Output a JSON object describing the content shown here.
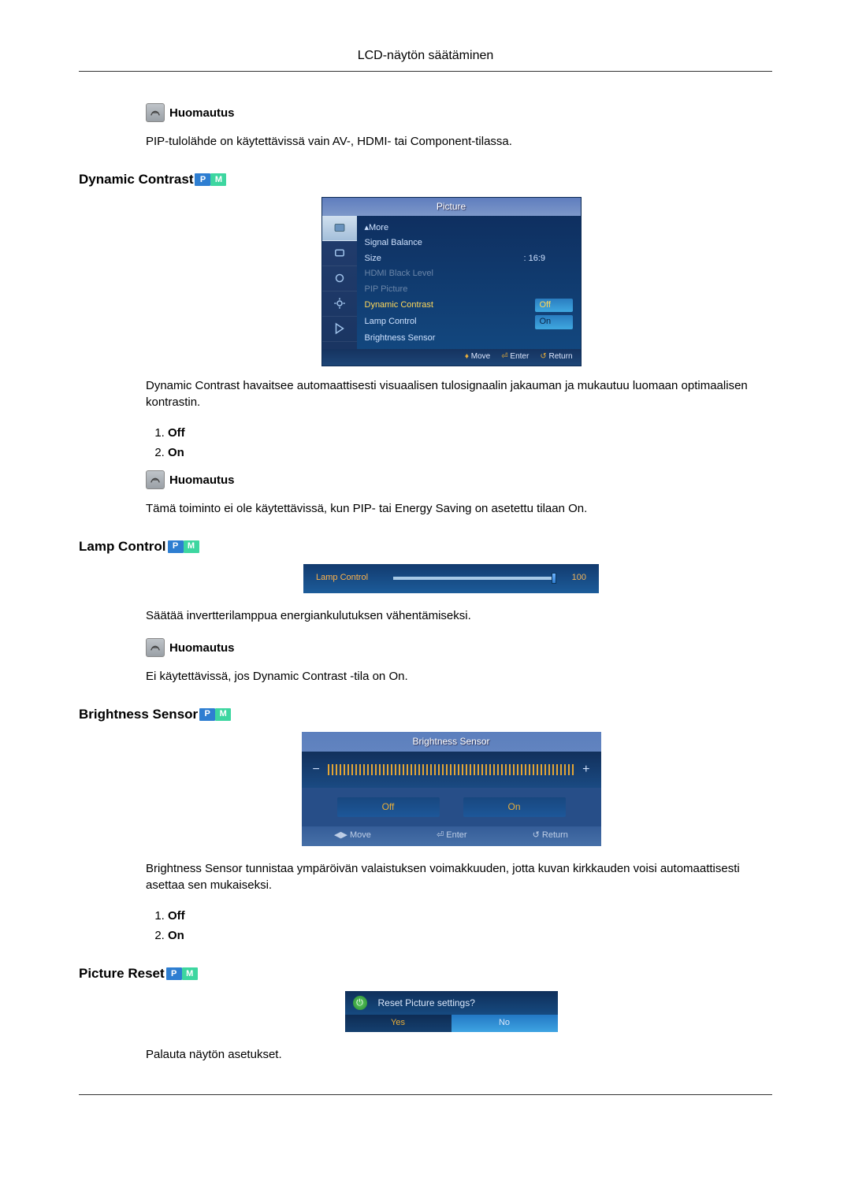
{
  "header": {
    "title": "LCD-näytön säätäminen"
  },
  "badges": {
    "p": "P",
    "m": "M"
  },
  "note": {
    "label": "Huomautus"
  },
  "pip_note_text": "PIP-tulolähde on käytettävissä vain AV-, HDMI- tai Component-tilassa.",
  "dynamic_contrast": {
    "heading": "Dynamic Contrast",
    "menu": {
      "title": "Picture",
      "rows": {
        "more": "▴More",
        "signal_balance": "Signal Balance",
        "size": "Size",
        "size_val": ": 16:9",
        "hdmi_black": "HDMI Black Level",
        "pip_picture": "PIP Picture",
        "dynamic_contrast": "Dynamic Contrast",
        "dc_val": "Off",
        "lamp_control": "Lamp Control",
        "lc_val": "On",
        "brightness_sensor": "Brightness Sensor"
      },
      "footer": {
        "move": "Move",
        "enter": "Enter",
        "return": "Return"
      }
    },
    "description": "Dynamic Contrast havaitsee automaattisesti visuaalisen tulosignaalin jakauman ja mukautuu luomaan optimaalisen kontrastin.",
    "options": {
      "off": "Off",
      "on": "On"
    },
    "note_text": "Tämä toiminto ei ole käytettävissä, kun PIP- tai Energy Saving on asetettu tilaan On."
  },
  "lamp_control": {
    "heading": "Lamp Control",
    "slider": {
      "label": "Lamp Control",
      "value": "100"
    },
    "description": "Säätää invertterilamppua energiankulutuksen vähentämiseksi.",
    "note_text": "Ei käytettävissä, jos Dynamic Contrast -tila on On."
  },
  "brightness_sensor": {
    "heading": "Brightness Sensor ",
    "menu": {
      "title": "Brightness Sensor",
      "minus": "−",
      "plus": "+",
      "off": "Off",
      "on": "On",
      "footer": {
        "move": "Move",
        "enter": "Enter",
        "return": "Return"
      }
    },
    "description": "Brightness Sensor tunnistaa ympäröivän valaistuksen voimakkuuden, jotta kuvan kirkkauden voisi automaattisesti asettaa sen mukaiseksi.",
    "options": {
      "off": "Off",
      "on": "On"
    }
  },
  "picture_reset": {
    "heading": "Picture Reset",
    "dialog": {
      "question": "Reset Picture settings?",
      "yes": "Yes",
      "no": "No"
    },
    "description": "Palauta näytön asetukset."
  }
}
